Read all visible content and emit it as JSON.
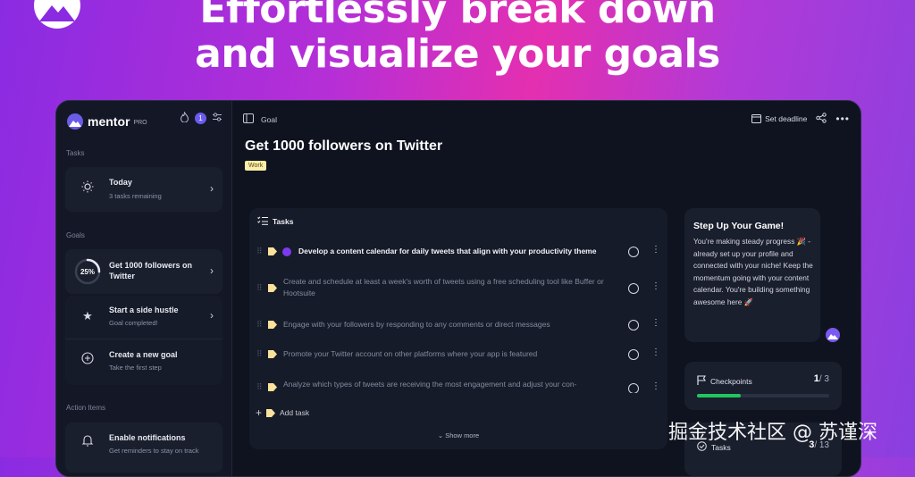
{
  "headline": {
    "line1": "Effortlessly break down",
    "line2": "and visualize your goals"
  },
  "app": {
    "logo_text": "mentor",
    "logo_pro": "PRO",
    "streak_count": "1",
    "sidebar": {
      "tasks_label": "Tasks",
      "today": {
        "title": "Today",
        "subtitle": "3 tasks remaining"
      },
      "goals_label": "Goals",
      "goals": [
        {
          "percent": "25%",
          "progress": 0.25,
          "title": "Get 1000 followers on Twitter"
        },
        {
          "title": "Start a side hustle",
          "subtitle": "Goal completed!"
        },
        {
          "title": "Create a new goal",
          "subtitle": "Take the first step"
        }
      ],
      "action_label": "Action Items",
      "notifications": {
        "title": "Enable notifications",
        "subtitle": "Get reminders to stay on track"
      }
    },
    "topbar": {
      "breadcrumb": "Goal",
      "set_deadline": "Set deadline"
    },
    "goal": {
      "title": "Get 1000 followers on Twitter",
      "tag": "Work"
    },
    "tasks": {
      "header": "Tasks",
      "items": [
        "Develop a content calendar for daily tweets that align with your productivity theme",
        "Create and schedule at least a week's worth of tweets using a free scheduling tool like Buffer or Hootsuite",
        "Engage with your followers by responding to any comments or direct messages",
        "Promote your Twitter account on other platforms where your app is featured",
        "Analyze which types of tweets are receiving the most engagement and adjust your con-"
      ],
      "add_task": "Add task",
      "show_more": "Show more"
    },
    "coach": {
      "title": "Step Up Your Game!",
      "message": "You're making steady progress 🎉 - already set up your profile and connected with your niche! Keep the momentum going with your content calendar. You're building something awesome here 🚀"
    },
    "checkpoints": {
      "label": "Checkpoints",
      "done": "1",
      "total": "/ 3",
      "progress": 0.333
    },
    "tasks_stat": {
      "label": "Tasks",
      "done": "3",
      "total": "/ 13"
    }
  },
  "watermark": "掘金技术社区 @ 苏谨深",
  "colors": {
    "accent": "#6a5cf0",
    "progress_green": "#22c55e",
    "tag_bg": "#fbeea9"
  }
}
